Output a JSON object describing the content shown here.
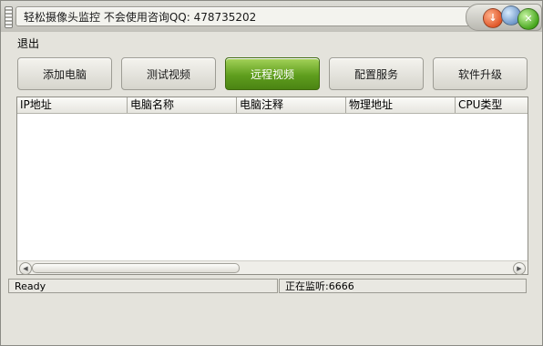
{
  "window": {
    "title": "轻松摄像头监控   不会使用咨询QQ: 478735202"
  },
  "title_controls": {
    "minimize_symbol": "↓",
    "close_symbol": "✕"
  },
  "menu": {
    "items": [
      {
        "label": "退出"
      }
    ]
  },
  "toolbar": {
    "buttons": [
      {
        "label": "添加电脑",
        "active": false
      },
      {
        "label": "测试视频",
        "active": false
      },
      {
        "label": "远程视频",
        "active": true
      },
      {
        "label": "配置服务",
        "active": false
      },
      {
        "label": "软件升级",
        "active": false
      }
    ]
  },
  "list": {
    "columns": [
      "IP地址",
      "电脑名称",
      "电脑注释",
      "物理地址",
      "CPU类型"
    ],
    "rows": []
  },
  "status": {
    "left": "Ready",
    "right": "正在监听:6666"
  },
  "colors": {
    "active_button": "#5f9e1e",
    "window_bg": "#e4e3dc"
  }
}
